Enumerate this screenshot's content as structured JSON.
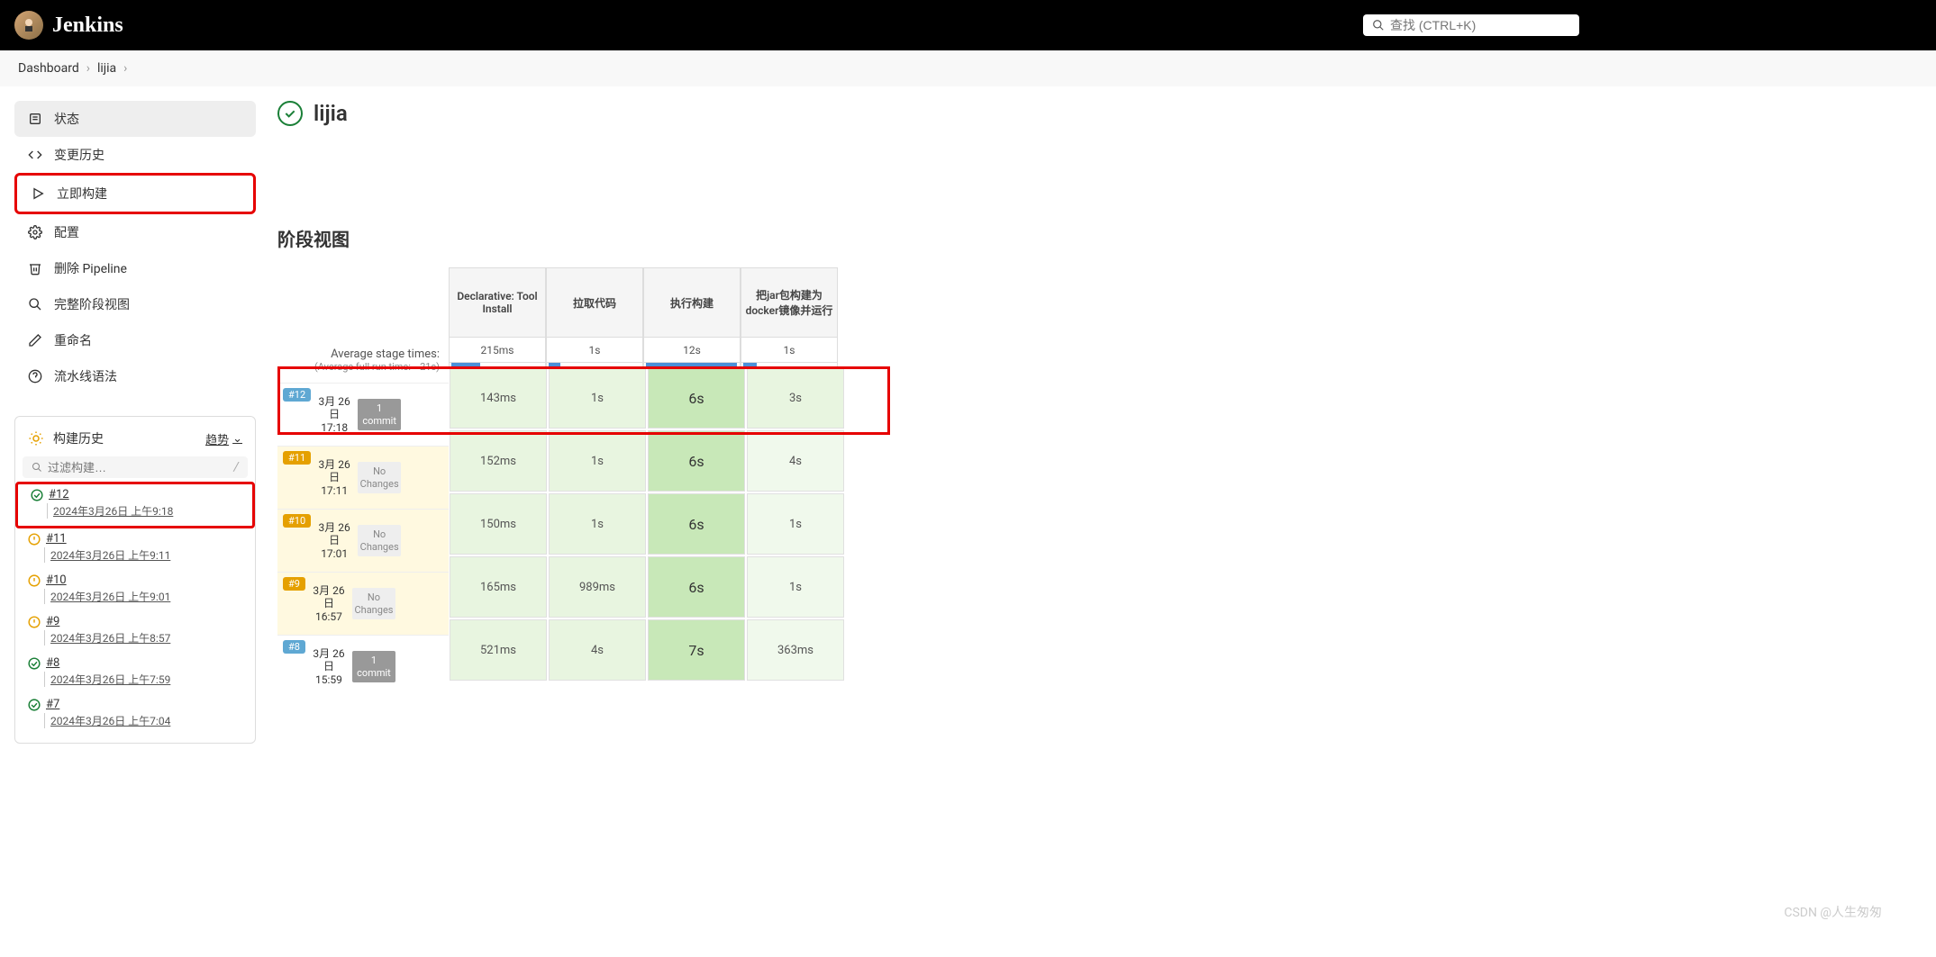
{
  "header": {
    "brand": "Jenkins",
    "search_placeholder": "查找 (CTRL+K)"
  },
  "breadcrumb": {
    "root": "Dashboard",
    "job": "lijia"
  },
  "sidebar": {
    "items": [
      {
        "label": "状态",
        "icon": "status"
      },
      {
        "label": "变更历史",
        "icon": "changes"
      },
      {
        "label": "立即构建",
        "icon": "play"
      },
      {
        "label": "配置",
        "icon": "gear"
      },
      {
        "label": "删除 Pipeline",
        "icon": "trash"
      },
      {
        "label": "完整阶段视图",
        "icon": "search"
      },
      {
        "label": "重命名",
        "icon": "pencil"
      },
      {
        "label": "流水线语法",
        "icon": "help"
      }
    ]
  },
  "build_history": {
    "title": "构建历史",
    "trend_label": "趋势",
    "filter_placeholder": "过滤构建…",
    "entries": [
      {
        "id": "#12",
        "date": "2024年3月26日 上午9:18",
        "status": "ok"
      },
      {
        "id": "#11",
        "date": "2024年3月26日 上午9:11",
        "status": "warn"
      },
      {
        "id": "#10",
        "date": "2024年3月26日 上午9:01",
        "status": "warn"
      },
      {
        "id": "#9",
        "date": "2024年3月26日 上午8:57",
        "status": "warn"
      },
      {
        "id": "#8",
        "date": "2024年3月26日 上午7:59",
        "status": "ok"
      },
      {
        "id": "#7",
        "date": "2024年3月26日 上午7:04",
        "status": "ok"
      }
    ]
  },
  "job": {
    "name": "lijia",
    "section_title": "阶段视图"
  },
  "stage_view": {
    "avg_label": "Average stage times:",
    "avg_sub": "(Average full run time: ~21s)",
    "stages": [
      "Declarative: Tool Install",
      "拉取代码",
      "执行构建",
      "把jar包构建为docker镜像并运行"
    ],
    "avg_times": [
      "215ms",
      "1s",
      "12s",
      "1s"
    ],
    "runs": [
      {
        "badge": "#12",
        "badge_color": "blue",
        "date": "3月 26日",
        "time": "17:18",
        "changes_label": "1 commit",
        "changes_type": "commit",
        "cells": [
          "143ms",
          "1s",
          "6s",
          "3s"
        ]
      },
      {
        "badge": "#11",
        "badge_color": "yellow",
        "date": "3月 26日",
        "time": "17:11",
        "changes_label": "No Changes",
        "changes_type": "none",
        "cells": [
          "152ms",
          "1s",
          "6s",
          "4s"
        ]
      },
      {
        "badge": "#10",
        "badge_color": "yellow",
        "date": "3月 26日",
        "time": "17:01",
        "changes_label": "No Changes",
        "changes_type": "none",
        "cells": [
          "150ms",
          "1s",
          "6s",
          "1s"
        ]
      },
      {
        "badge": "#9",
        "badge_color": "yellow",
        "date": "3月 26日",
        "time": "16:57",
        "changes_label": "No Changes",
        "changes_type": "none",
        "cells": [
          "165ms",
          "989ms",
          "6s",
          "1s"
        ]
      },
      {
        "badge": "#8",
        "badge_color": "blue",
        "date": "3月 26日",
        "time": "15:59",
        "changes_label": "1 commit",
        "changes_type": "commit",
        "cells": [
          "521ms",
          "4s",
          "7s",
          "363ms"
        ]
      }
    ]
  },
  "watermark": "CSDN @人生匆匆"
}
